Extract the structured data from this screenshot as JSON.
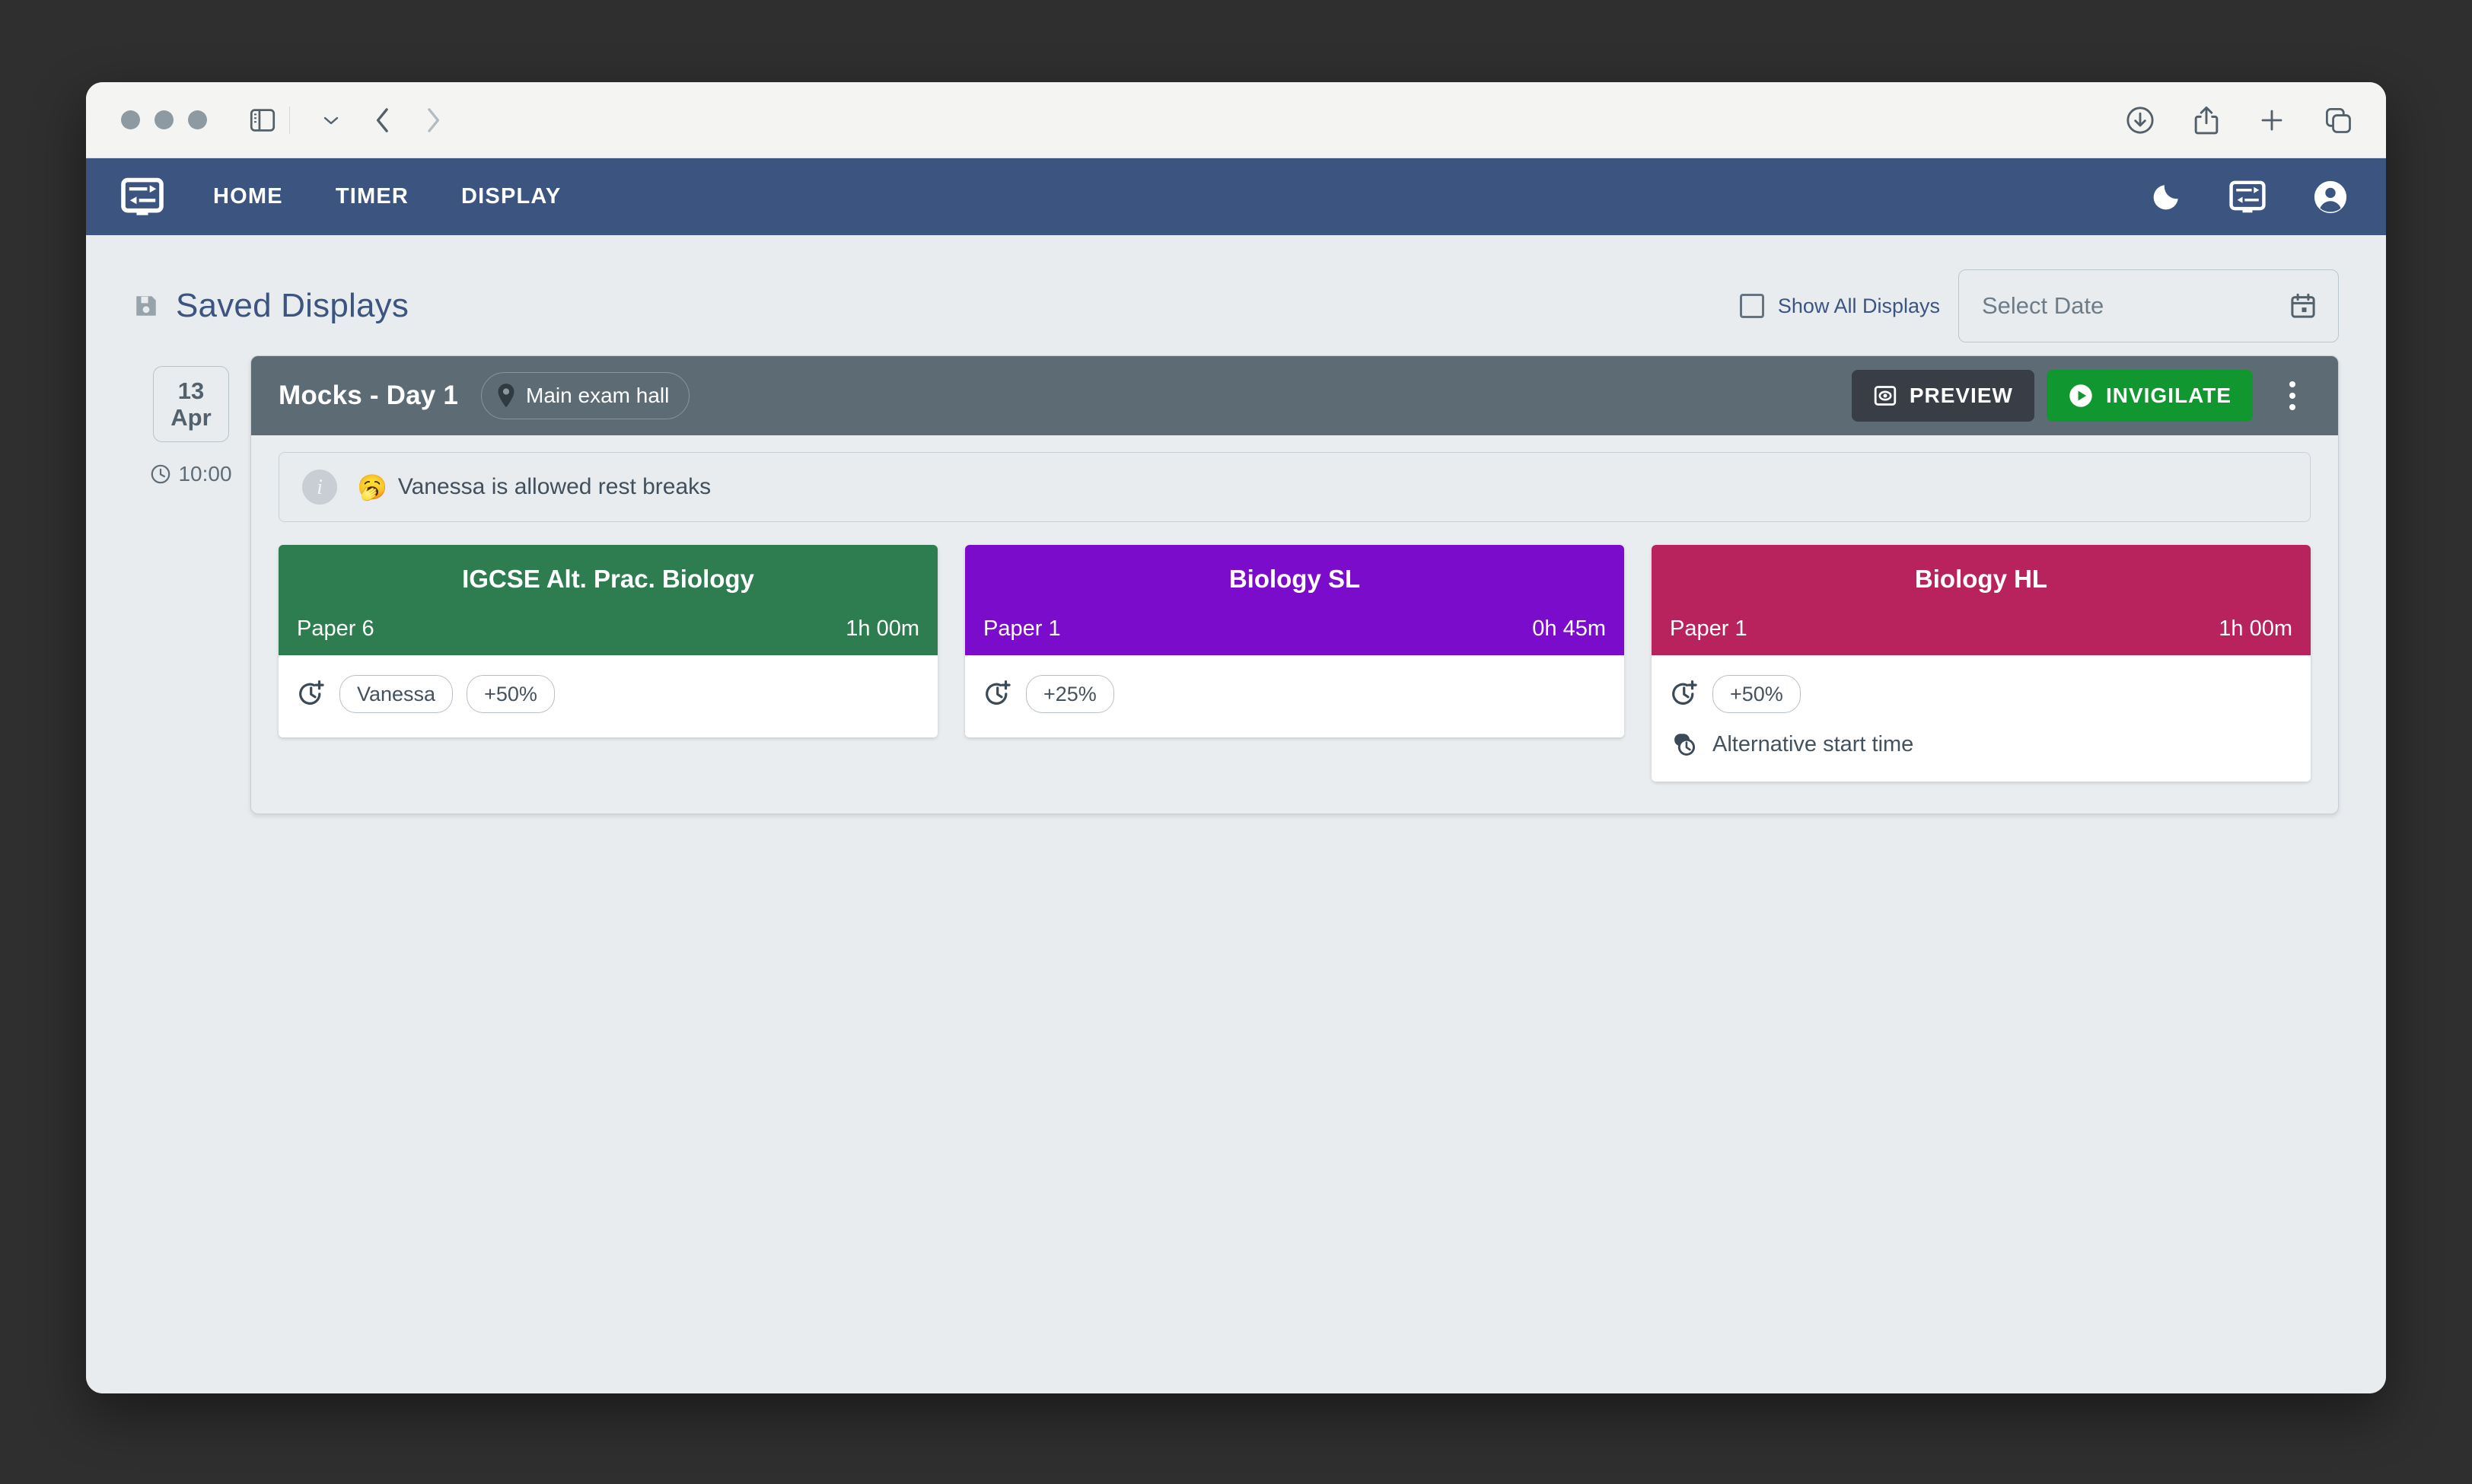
{
  "browser": {
    "url": "localhost",
    "icons": {
      "traffic_close": "close-window-dot",
      "traffic_minimize": "minimize-window-dot",
      "traffic_zoom": "zoom-window-dot",
      "sidebar": "sidebar-toggle-icon",
      "sidebar_chevron": "chevron-down-icon",
      "back": "back-arrow-icon",
      "forward": "forward-arrow-icon",
      "reload": "reload-icon",
      "downloads": "download-icon",
      "share": "share-icon",
      "new_tab": "plus-icon",
      "tab_overview": "tab-overview-icon"
    }
  },
  "navbar": {
    "logo_icon": "display-settings-logo-icon",
    "tabs": [
      {
        "label": "HOME",
        "name": "nav-tab-home"
      },
      {
        "label": "TIMER",
        "name": "nav-tab-timer"
      },
      {
        "label": "DISPLAY",
        "name": "nav-tab-display"
      }
    ],
    "right_icons": [
      {
        "name": "dark-mode-moon-icon"
      },
      {
        "name": "display-settings-icon"
      },
      {
        "name": "account-circle-icon"
      }
    ],
    "background_color": "#3b5480"
  },
  "header": {
    "title": "Saved Displays",
    "save_icon": "save-floppy-icon",
    "show_all_label": "Show All Displays",
    "show_all_checked": false,
    "date_picker_placeholder": "Select Date",
    "date_picker_value": "Select Date",
    "calendar_icon": "calendar-icon"
  },
  "schedule": {
    "date_day": "13",
    "date_month": "Apr",
    "start_time": "10:00",
    "clock_icon": "clock-icon"
  },
  "display_card": {
    "name": "Mocks - Day 1",
    "location": "Main exam hall",
    "location_icon": "location-pin-icon",
    "preview_label": "PREVIEW",
    "preview_icon": "preview-eye-icon",
    "invigilate_label": "INVIGILATE",
    "invigilate_icon": "play-circle-icon",
    "menu_icon": "more-vertical-icon",
    "header_color": "#5d6b74",
    "preview_color": "#383d46",
    "invigilate_color": "#10972f",
    "note": {
      "info_icon": "info-icon",
      "emoji": "🥱",
      "text": "Vanessa is allowed rest breaks"
    },
    "exams": [
      {
        "title": "IGCSE Alt. Prac. Biology",
        "paper": "Paper 6",
        "duration": "1h 00m",
        "color": "#2e7d50",
        "extra_time_icon": "clock-plus-icon",
        "pills": [
          "Vanessa",
          "+50%"
        ],
        "alt_start": null,
        "alt_start_icon": null
      },
      {
        "title": "Biology SL",
        "paper": "Paper 1",
        "duration": "0h 45m",
        "color": "#7b0ccc",
        "extra_time_icon": "clock-plus-icon",
        "pills": [
          "+25%"
        ],
        "alt_start": null,
        "alt_start_icon": null
      },
      {
        "title": "Biology HL",
        "paper": "Paper 1",
        "duration": "1h 00m",
        "color": "#b8235e",
        "extra_time_icon": "clock-plus-icon",
        "pills": [
          "+50%"
        ],
        "alt_start": "Alternative start time",
        "alt_start_icon": "alarm-clock-icon"
      }
    ]
  }
}
